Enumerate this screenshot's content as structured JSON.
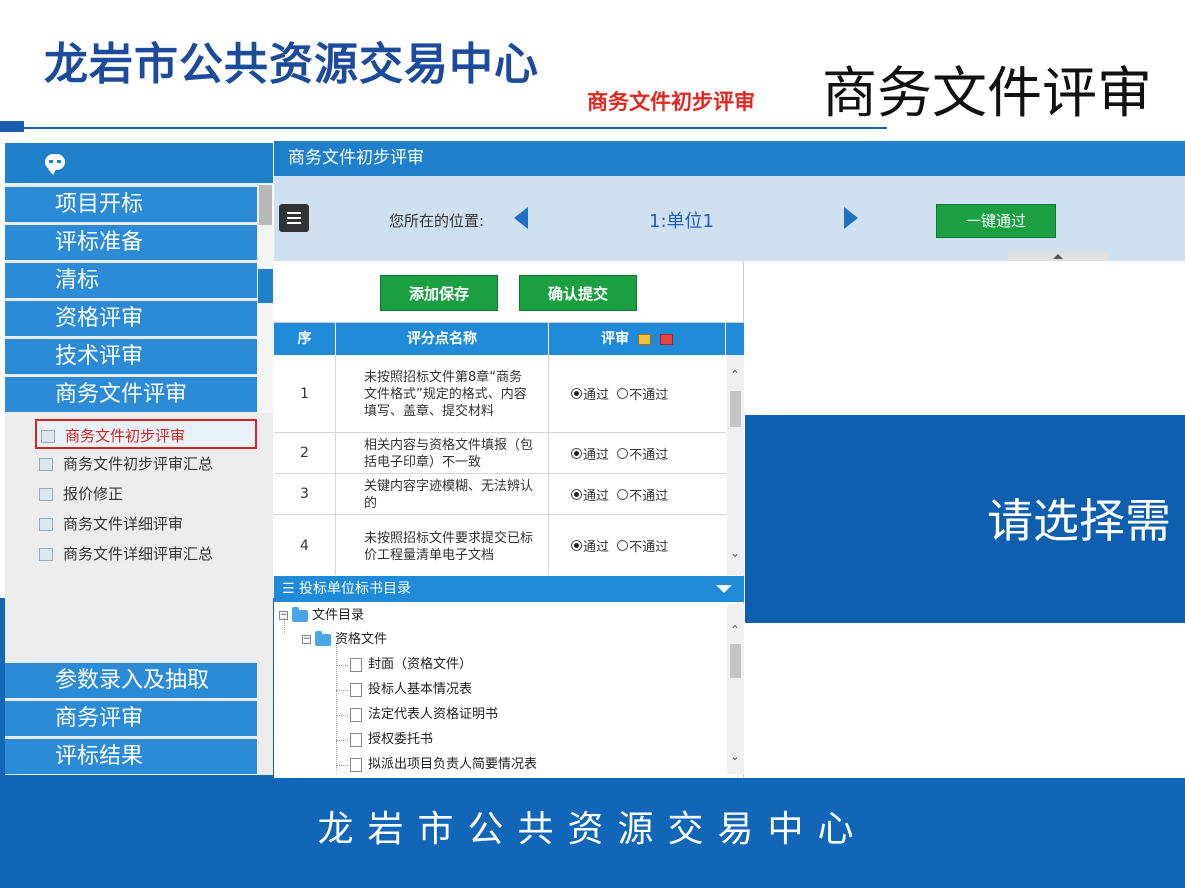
{
  "header": {
    "org_title": "龙岩市公共资源交易中心",
    "subtitle_red": "商务文件初步评审",
    "big_title": "商务文件评审"
  },
  "footer": {
    "text": "龙岩市公共资源交易中心"
  },
  "leftnav": {
    "items_top": [
      "项目开标",
      "评标准备",
      "清标",
      "资格评审",
      "技术评审",
      "商务文件评审"
    ],
    "sub_items": [
      "商务文件初步评审",
      "商务文件初步评审汇总",
      "报价修正",
      "商务文件详细评审",
      "商务文件详细评审汇总"
    ],
    "active_sub": "商务文件初步评审",
    "items_bottom": [
      "参数录入及抽取",
      "商务评审",
      "评标结果"
    ]
  },
  "app": {
    "title": "商务文件初步评审",
    "location_label": "您所在的位置:",
    "unit": "1:单位1",
    "pass_all_button": "一键通过",
    "save_button": "添加保存",
    "submit_button": "确认提交",
    "table": {
      "headers": [
        "序",
        "评分点名称",
        "评审"
      ],
      "rows": [
        {
          "seq": "1",
          "name": "未按照招标文件第8章“商务文件格式”规定的格式、内容填写、盖章、提交材料",
          "pass": "通过",
          "fail": "不通过"
        },
        {
          "seq": "2",
          "name": "相关内容与资格文件填报（包括电子印章）不一致",
          "pass": "通过",
          "fail": "不通过"
        },
        {
          "seq": "3",
          "name": "关键内容字迹模糊、无法辨认的",
          "pass": "通过",
          "fail": "不通过"
        },
        {
          "seq": "4",
          "name": "未按照招标文件要求提交已标价工程量清单电子文档",
          "pass": "通过",
          "fail": "不通过"
        }
      ]
    },
    "directory": {
      "title": "投标单位标书目录",
      "root": "文件目录",
      "folder": "资格文件",
      "files": [
        "封面（资格文件）",
        "投标人基本情况表",
        "法定代表人资格证明书",
        "授权委托书",
        "拟派出项目负责人简要情况表"
      ]
    },
    "right_message": "请选择需"
  },
  "colors": {
    "header_blue": "#1c4b9c",
    "accent_red": "#e3261f",
    "nav_blue": "#2b8bd6",
    "button_green": "#1aa040",
    "band_blue": "#1266b8"
  }
}
